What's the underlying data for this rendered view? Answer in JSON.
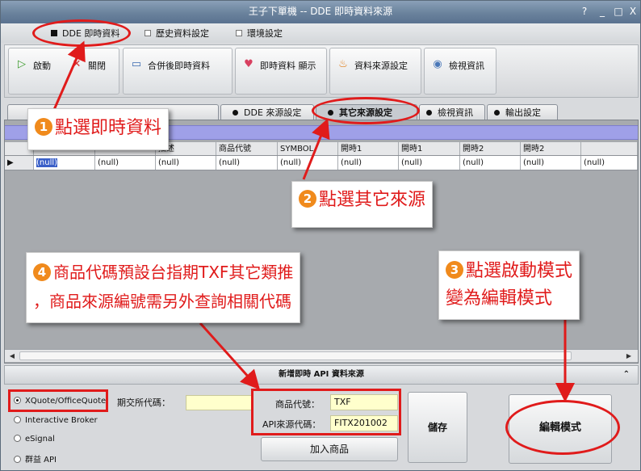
{
  "window": {
    "title": "王子下單機 -- DDE 即時資料來源",
    "controls": [
      "?",
      "_",
      "□",
      "X"
    ]
  },
  "menu": {
    "tabs": [
      "DDE 即時資料",
      "歷史資料設定",
      "環境設定"
    ]
  },
  "toolbar": {
    "buttons": [
      {
        "label": "啟動",
        "icon": "play-icon"
      },
      {
        "label": "關閉",
        "icon": "close-icon"
      },
      {
        "label": "合併後即時資料",
        "icon": "monitor-icon"
      },
      {
        "label": "即時資料 顯示",
        "icon": "heart-icon"
      },
      {
        "label": "資料來源設定",
        "icon": "flame-icon"
      },
      {
        "label": "檢視資訊",
        "icon": "disc-icon"
      }
    ]
  },
  "tabs": [
    "DDE 來源設定",
    "其它來源設定",
    "檢視資訊",
    "輸出設定"
  ],
  "grid": {
    "columns": [
      "",
      "",
      "",
      "描述",
      "商品代號",
      "SYMBOL",
      "開時1",
      "開時1",
      "開時2",
      "開時2"
    ],
    "row": [
      "(null)",
      "(null)",
      "(null)",
      "(null)",
      "(null)",
      "(null)",
      "(null)",
      "(null)",
      "(null)",
      "(null)"
    ]
  },
  "bottom": {
    "title": "新增即時 API 資料來源",
    "radios": [
      "XQuote/OfficeQuote",
      "Interactive Broker",
      "eSignal",
      "群益 API"
    ],
    "futures_label": "期交所代碼：",
    "product_code_label": "商品代號：",
    "product_code_value": "TXF",
    "api_code_label": "API來源代碼：",
    "api_code_value": "FITX201002",
    "add_button": "加入商品",
    "save_button": "儲存",
    "edit_mode_button": "編輯模式"
  },
  "annotations": {
    "step1": {
      "num": "1",
      "text": "點選即時資料"
    },
    "step2": {
      "num": "2",
      "text": "點選其它來源"
    },
    "step3": {
      "num": "3",
      "line1": "點選啟動模式",
      "line2": "變為編輯模式"
    },
    "step4": {
      "num": "4",
      "line1": "商品代碼預設台指期TXF其它類推",
      "line2": "，商品來源編號需另外查詢相關代碼"
    }
  },
  "colors": {
    "annotation_red": "#e01b1b",
    "step_badge": "#f08a1c",
    "highlight_field": "#ffffcc",
    "grid_band": "#9fa0e8"
  }
}
